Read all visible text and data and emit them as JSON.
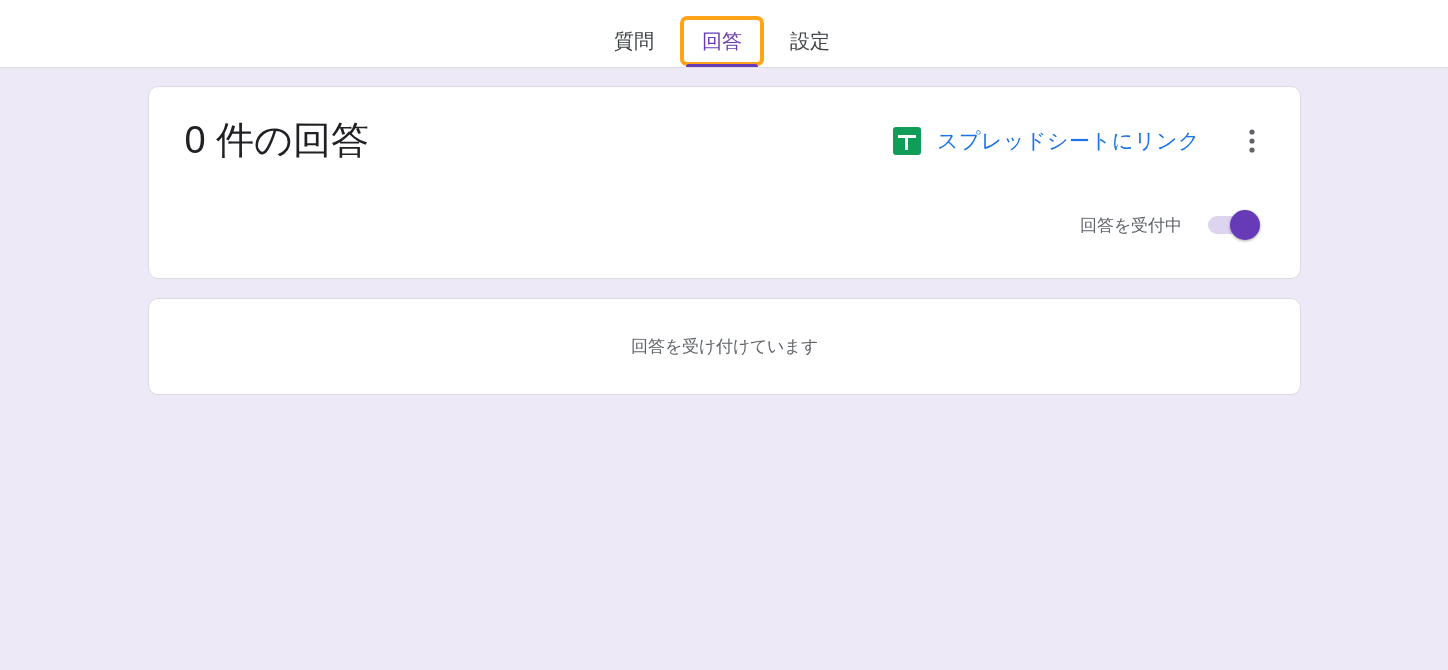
{
  "tabs": [
    {
      "label": "質問",
      "selected": false,
      "highlighted": false
    },
    {
      "label": "回答",
      "selected": true,
      "highlighted": true
    },
    {
      "label": "設定",
      "selected": false,
      "highlighted": false
    }
  ],
  "summary": {
    "title": "0 件の回答",
    "link": "スプレッドシートにリンク",
    "accepting_label": "回答を受付中",
    "accepting": {
      "on": true
    }
  },
  "message": "回答を受け付けています"
}
